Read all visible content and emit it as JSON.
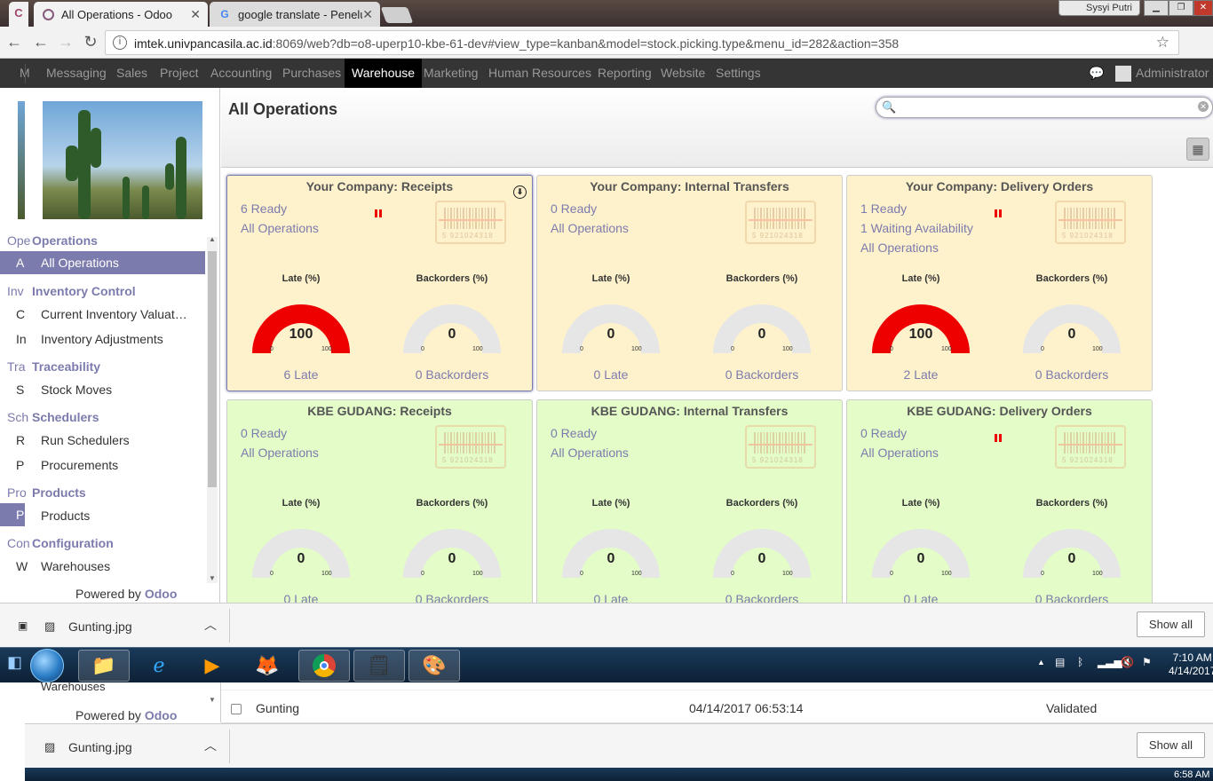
{
  "browser": {
    "tabs": [
      {
        "title": "All Operations - Odoo",
        "icon": "odoo-icon"
      },
      {
        "title": "google translate - Penelu",
        "icon": "google-icon"
      }
    ],
    "window_user": "Sysyi Putri",
    "url_host": "imtek.univpancasila.ac.id",
    "url_rest": ":8069/web?db=o8-uperp10-kbe-61-dev#view_type=kanban&model=stock.picking.type&menu_id=282&action=358"
  },
  "topbar": {
    "cut_item": "M",
    "menu": [
      "Messaging",
      "Sales",
      "Project",
      "Accounting",
      "Purchases",
      "Warehouse",
      "Marketing",
      "Human Resources",
      "Reporting",
      "Website",
      "Settings"
    ],
    "active": "Warehouse",
    "user": "Administrator"
  },
  "sidebar": {
    "sections": [
      {
        "cut": "Ope",
        "title": "Operations",
        "items": [
          {
            "cut": "A",
            "label": "All Operations",
            "active": true
          }
        ]
      },
      {
        "cut": "Inv",
        "title": "Inventory Control",
        "items": [
          {
            "cut": "C",
            "label": "Current Inventory Valuat…"
          },
          {
            "cut": "In",
            "label": "Inventory Adjustments"
          }
        ]
      },
      {
        "cut": "Tra",
        "title": "Traceability",
        "items": [
          {
            "cut": "S",
            "label": "Stock Moves"
          }
        ]
      },
      {
        "cut": "Sch",
        "title": "Schedulers",
        "items": [
          {
            "cut": "R",
            "label": "Run Schedulers"
          },
          {
            "cut": "P",
            "label": "Procurements"
          }
        ]
      },
      {
        "cut": "Pro",
        "title": "Products",
        "items": [
          {
            "cut": "P",
            "label": "Products"
          }
        ]
      },
      {
        "cut": "Con",
        "title": "Configuration",
        "items": [
          {
            "cut": "W",
            "label": "Warehouses"
          }
        ]
      }
    ],
    "powered_prefix": "Powered by",
    "powered_brand": "Odoo"
  },
  "main": {
    "title": "All Operations",
    "search_placeholder": ""
  },
  "cards": [
    {
      "title": "Your Company: Receipts",
      "color": "#fef2cc",
      "links": [
        "6 Ready",
        "All Operations"
      ],
      "flag": true,
      "late": 100,
      "backorders": 0,
      "late_text": "6 Late",
      "back_text": "0 Backorders",
      "selected": true
    },
    {
      "title": "Your Company: Internal Transfers",
      "color": "#fef2cc",
      "links": [
        "0 Ready",
        "All Operations"
      ],
      "flag": false,
      "late": 0,
      "backorders": 0,
      "late_text": "0 Late",
      "back_text": "0 Backorders",
      "selected": false
    },
    {
      "title": "Your Company: Delivery Orders",
      "color": "#fef2cc",
      "links": [
        "1 Ready",
        "1 Waiting Availability",
        "All Operations"
      ],
      "flag": true,
      "late": 100,
      "backorders": 0,
      "late_text": "2 Late",
      "back_text": "0 Backorders",
      "selected": false
    },
    {
      "title": "KBE GUDANG: Receipts",
      "color": "#e3fcc8",
      "links": [
        "0 Ready",
        "All Operations"
      ],
      "flag": false,
      "late": 0,
      "backorders": 0,
      "late_text": "0 Late",
      "back_text": "0 Backorders",
      "selected": false
    },
    {
      "title": "KBE GUDANG: Internal Transfers",
      "color": "#e3fcc8",
      "links": [
        "0 Ready",
        "All Operations"
      ],
      "flag": false,
      "late": 0,
      "backorders": 0,
      "late_text": "0 Late",
      "back_text": "0 Backorders",
      "selected": false
    },
    {
      "title": "KBE GUDANG: Delivery Orders",
      "color": "#e3fcc8",
      "links": [
        "0 Ready",
        "All Operations"
      ],
      "flag": true,
      "late": 0,
      "backorders": 0,
      "late_text": "0 Late",
      "back_text": "0 Backorders",
      "selected": false
    }
  ],
  "gauge": {
    "late_label": "Late (%)",
    "back_label": "Backorders (%)",
    "min": "0",
    "max": "100",
    "barcode_number": "5 921024318"
  },
  "downloads": {
    "file": "Gunting.jpg",
    "show_all": "Show all"
  },
  "taskbar": {
    "time": "7:10 AM",
    "date": "4/14/2017"
  },
  "lower": {
    "sidebar_item": "Warehouses",
    "powered_prefix": "Powered by",
    "powered_brand": "Odoo",
    "row": {
      "name": "Gunting",
      "date": "04/14/2017 06:53:14",
      "status": "Validated"
    },
    "file": "Gunting.jpg",
    "show_all": "Show all",
    "time": "6:58 AM"
  }
}
